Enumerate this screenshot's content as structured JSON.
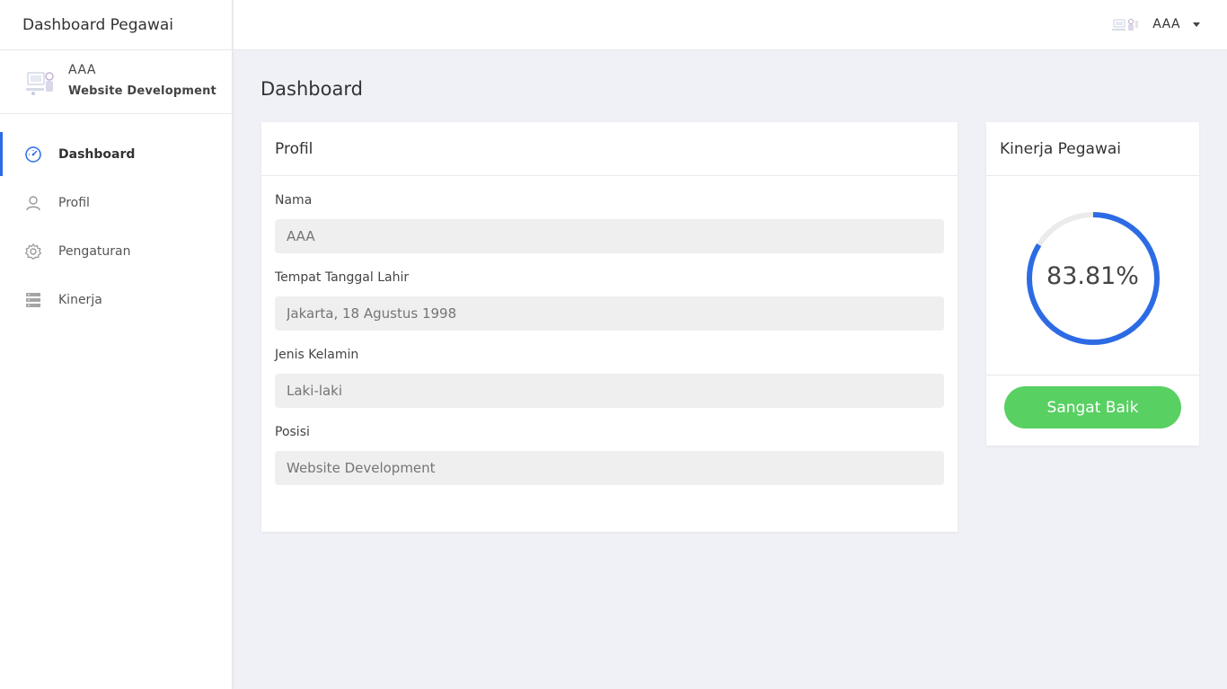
{
  "brand": {
    "title": "Dashboard Pegawai"
  },
  "sidebar": {
    "user": {
      "name": "AAA",
      "role": "Website Development"
    },
    "items": [
      {
        "label": "Dashboard",
        "icon": "dashboard-gauge-icon",
        "active": true
      },
      {
        "label": "Profil",
        "icon": "user-icon",
        "active": false
      },
      {
        "label": "Pengaturan",
        "icon": "gear-icon",
        "active": false
      },
      {
        "label": "Kinerja",
        "icon": "server-list-icon",
        "active": false
      }
    ]
  },
  "topbar": {
    "user_name": "AAA"
  },
  "main": {
    "page_title": "Dashboard",
    "profil": {
      "title": "Profil",
      "fields": [
        {
          "label": "Nama",
          "placeholder": "AAA"
        },
        {
          "label": "Tempat Tanggal Lahir",
          "placeholder": "Jakarta, 18 Agustus 1998"
        },
        {
          "label": "Jenis Kelamin",
          "placeholder": "Laki-laki"
        },
        {
          "label": "Posisi",
          "placeholder": "Website Development"
        }
      ]
    },
    "kinerja": {
      "title": "Kinerja Pegawai",
      "percent_label": "83.81%",
      "percent_value": 83.81,
      "status_label": "Sangat Baik"
    }
  },
  "colors": {
    "accent": "#2d6be5",
    "gauge_track": "#ebebeb",
    "success": "#58d062",
    "input_bg": "#efefef"
  }
}
